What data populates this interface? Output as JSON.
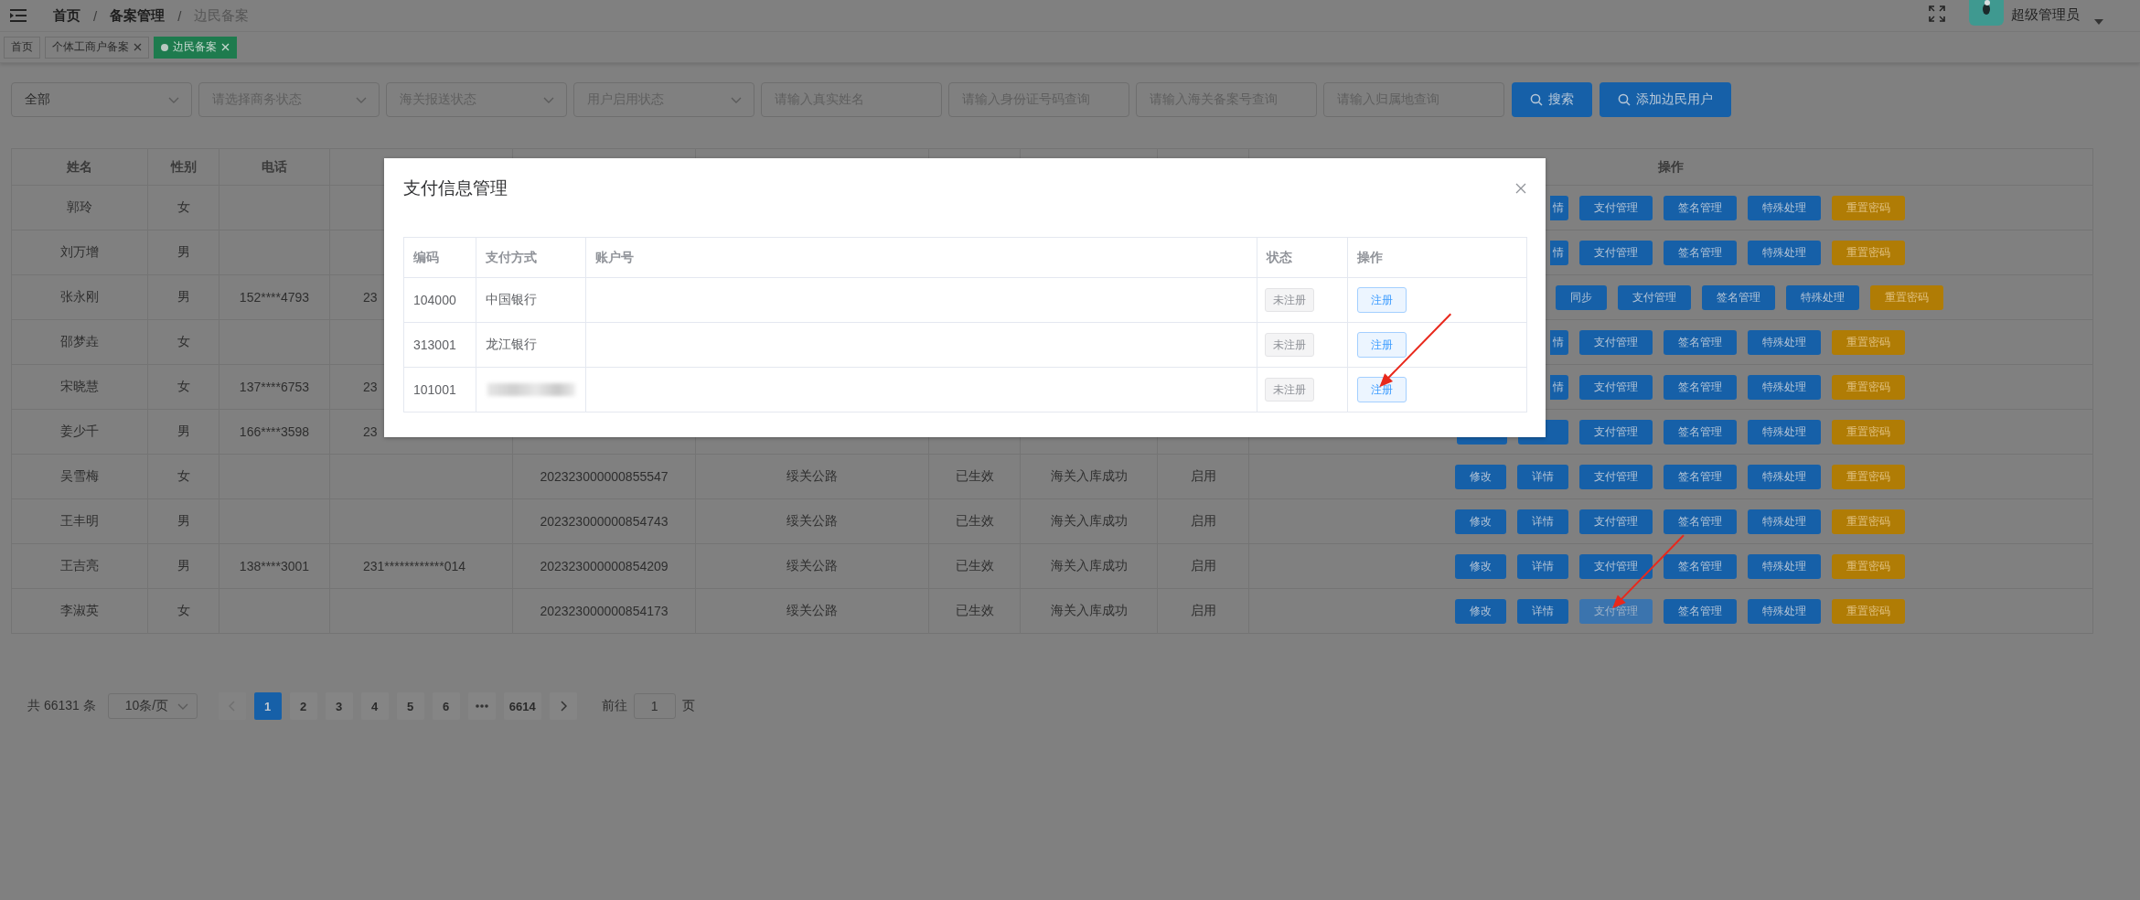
{
  "topbar": {
    "separator": "/",
    "breadcrumb": [
      {
        "label": "首页",
        "current": false
      },
      {
        "label": "备案管理",
        "current": false
      },
      {
        "label": "边民备案",
        "current": true
      }
    ],
    "user": "超级管理员"
  },
  "tags": [
    {
      "label": "首页",
      "closable": false,
      "selected": false
    },
    {
      "label": "个体工商户备案",
      "closable": true,
      "selected": false
    },
    {
      "label": "边民备案",
      "closable": true,
      "selected": true
    }
  ],
  "filters": [
    {
      "kind": "select",
      "value": "全部"
    },
    {
      "kind": "select",
      "placeholder": "请选择商务状态"
    },
    {
      "kind": "select",
      "placeholder": "海关报送状态"
    },
    {
      "kind": "select",
      "placeholder": "用户启用状态"
    },
    {
      "kind": "input",
      "placeholder": "请输入真实姓名"
    },
    {
      "kind": "input",
      "placeholder": "请输入身份证号码查询"
    },
    {
      "kind": "input",
      "placeholder": "请输入海关备案号查询"
    },
    {
      "kind": "input",
      "placeholder": "请输入归属地查询"
    }
  ],
  "actions": [
    {
      "label": "搜索"
    },
    {
      "label": "添加边民用户"
    }
  ],
  "table": {
    "columns": {
      "column_1": "姓名",
      "column_2": "性别",
      "column_3": "电话",
      "column_10": "操作"
    },
    "rows": [
      {
        "column_1": "郭玲",
        "column_2": "女",
        "actions": [
          {
            "kind": "primary",
            "label": "情",
            "clipped": true
          },
          {
            "kind": "primary",
            "label": "支付管理"
          },
          {
            "kind": "primary",
            "label": "签名管理"
          },
          {
            "kind": "primary",
            "label": "特殊处理"
          },
          {
            "kind": "warning",
            "label": "重置密码"
          }
        ]
      },
      {
        "column_1": "刘万增",
        "column_2": "男",
        "actions": [
          {
            "kind": "primary",
            "label": "情",
            "clipped": true
          },
          {
            "kind": "primary",
            "label": "支付管理"
          },
          {
            "kind": "primary",
            "label": "签名管理"
          },
          {
            "kind": "primary",
            "label": "特殊处理"
          },
          {
            "kind": "warning",
            "label": "重置密码"
          }
        ]
      },
      {
        "column_1": "张永刚",
        "column_2": "男",
        "column_3": "152****4793",
        "column_4": "23",
        "actions": [
          {
            "kind": "primary",
            "label": "同步"
          },
          {
            "kind": "primary",
            "label": "支付管理"
          },
          {
            "kind": "primary",
            "label": "签名管理"
          },
          {
            "kind": "primary",
            "label": "特殊处理"
          },
          {
            "kind": "warning",
            "label": "重置密码"
          }
        ]
      },
      {
        "column_1": "邵梦垚",
        "column_2": "女",
        "actions": [
          {
            "kind": "primary",
            "label": "情",
            "clipped": true
          },
          {
            "kind": "primary",
            "label": "支付管理"
          },
          {
            "kind": "primary",
            "label": "签名管理"
          },
          {
            "kind": "primary",
            "label": "特殊处理"
          },
          {
            "kind": "warning",
            "label": "重置密码"
          }
        ]
      },
      {
        "column_1": "宋晓慧",
        "column_2": "女",
        "column_3": "137****6753",
        "column_4": "23",
        "actions": [
          {
            "kind": "primary",
            "label": "情",
            "clipped": true
          },
          {
            "kind": "primary",
            "label": "支付管理"
          },
          {
            "kind": "primary",
            "label": "签名管理"
          },
          {
            "kind": "primary",
            "label": "特殊处理"
          },
          {
            "kind": "warning",
            "label": "重置密码"
          }
        ]
      },
      {
        "column_1": "姜少千",
        "column_2": "男",
        "column_3": "166****3598",
        "column_4": "23",
        "actions": [
          {
            "kind": "primary"
          },
          {
            "kind": "primary"
          },
          {
            "kind": "primary",
            "label": "支付管理"
          },
          {
            "kind": "primary",
            "label": "签名管理"
          },
          {
            "kind": "primary",
            "label": "特殊处理"
          },
          {
            "kind": "warning",
            "label": "重置密码"
          }
        ]
      },
      {
        "column_1": "吴雪梅",
        "column_2": "女",
        "column_5": "202323000000855547",
        "column_6": "绥关公路",
        "column_7": "已生效",
        "column_8": "海关入库成功",
        "column_9": "启用",
        "actions": [
          {
            "kind": "primary",
            "label": "修改"
          },
          {
            "kind": "primary",
            "label": "详情"
          },
          {
            "kind": "primary",
            "label": "支付管理"
          },
          {
            "kind": "primary",
            "label": "签名管理"
          },
          {
            "kind": "primary",
            "label": "特殊处理"
          },
          {
            "kind": "warning",
            "label": "重置密码"
          }
        ]
      },
      {
        "column_1": "王丰明",
        "column_2": "男",
        "column_5": "202323000000854743",
        "column_6": "绥关公路",
        "column_7": "已生效",
        "column_8": "海关入库成功",
        "column_9": "启用",
        "actions": [
          {
            "kind": "primary",
            "label": "修改"
          },
          {
            "kind": "primary",
            "label": "详情"
          },
          {
            "kind": "primary",
            "label": "支付管理"
          },
          {
            "kind": "primary",
            "label": "签名管理"
          },
          {
            "kind": "primary",
            "label": "特殊处理"
          },
          {
            "kind": "warning",
            "label": "重置密码"
          }
        ]
      },
      {
        "column_1": "王吉亮",
        "column_2": "男",
        "column_3": "138****3001",
        "column_4": "231************014",
        "column_5": "202323000000854209",
        "column_6": "绥关公路",
        "column_7": "已生效",
        "column_8": "海关入库成功",
        "column_9": "启用",
        "actions": [
          {
            "kind": "primary",
            "label": "修改"
          },
          {
            "kind": "primary",
            "label": "详情"
          },
          {
            "kind": "primary",
            "label": "支付管理"
          },
          {
            "kind": "primary",
            "label": "签名管理"
          },
          {
            "kind": "primary",
            "label": "特殊处理"
          },
          {
            "kind": "warning",
            "label": "重置密码"
          }
        ]
      },
      {
        "column_1": "李淑英",
        "column_2": "女",
        "column_5": "202323000000854173",
        "column_6": "绥关公路",
        "column_7": "已生效",
        "column_8": "海关入库成功",
        "column_9": "启用",
        "actions": [
          {
            "kind": "primary",
            "label": "修改"
          },
          {
            "kind": "primary",
            "label": "详情"
          },
          {
            "kind": "primary",
            "label": "支付管理",
            "highlighted": true,
            "pointed": true
          },
          {
            "kind": "primary",
            "label": "签名管理"
          },
          {
            "kind": "primary",
            "label": "特殊处理"
          },
          {
            "kind": "warning",
            "label": "重置密码"
          }
        ]
      }
    ]
  },
  "pagination": {
    "total": "共 66131 条",
    "page_size": "10条/页",
    "pages": [
      {
        "kind": "page",
        "label": "1",
        "selected": true
      },
      {
        "kind": "page",
        "label": "2",
        "selected": false
      },
      {
        "kind": "page",
        "label": "3",
        "selected": false
      },
      {
        "kind": "page",
        "label": "4",
        "selected": false
      },
      {
        "kind": "page",
        "label": "5",
        "selected": false
      },
      {
        "kind": "page",
        "label": "6",
        "selected": false
      },
      {
        "kind": "more"
      },
      {
        "kind": "page",
        "label": "6614",
        "selected": false
      }
    ],
    "goto_label": "前往",
    "goto_value": "1",
    "goto_suffix": "页"
  },
  "dialog": {
    "title": "支付信息管理",
    "columns": [
      "编码",
      "支付方式",
      "账户号",
      "状态",
      "操作"
    ],
    "rows": [
      {
        "code": "104000",
        "method": "中国银行",
        "redacted": false,
        "status": "未注册",
        "action": "注册",
        "pointed": false
      },
      {
        "code": "313001",
        "method": "龙江银行",
        "redacted": false,
        "status": "未注册",
        "action": "注册",
        "pointed": false
      },
      {
        "code": "101001",
        "redacted": true,
        "status": "未注册",
        "action": "注册",
        "pointed": true
      }
    ]
  }
}
